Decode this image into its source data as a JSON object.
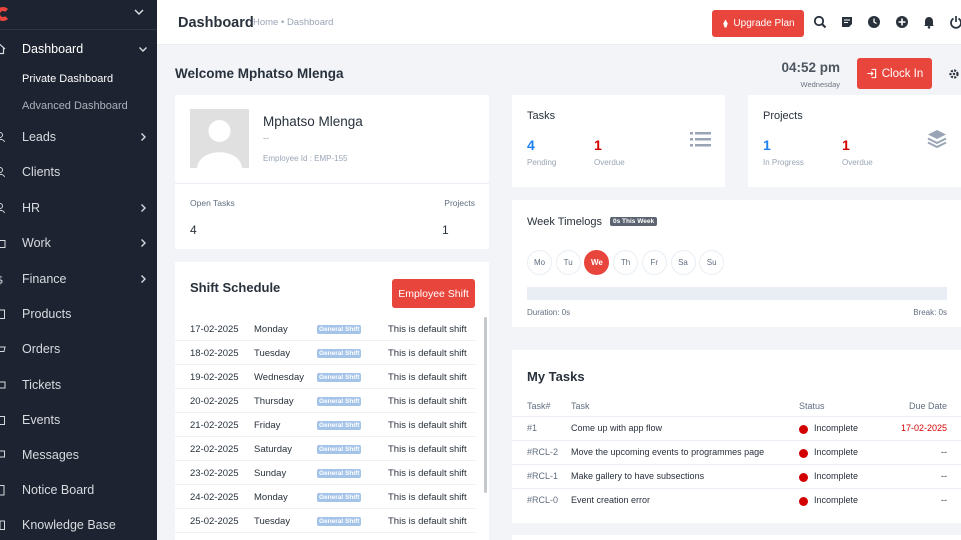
{
  "colors": {
    "accent": "#e8453c",
    "sidebar": "#1d2330",
    "blue": "#1d82f5",
    "red": "#d30000"
  },
  "sidebar": {
    "items": [
      {
        "label": "Dashboard",
        "icon": "house-icon",
        "chevron": "down"
      },
      {
        "label": "Leads",
        "icon": "user-icon",
        "chevron": "right"
      },
      {
        "label": "Clients",
        "icon": "users-icon",
        "chevron": ""
      },
      {
        "label": "HR",
        "icon": "people-icon",
        "chevron": "right"
      },
      {
        "label": "Work",
        "icon": "briefcase-icon",
        "chevron": "right"
      },
      {
        "label": "Finance",
        "icon": "dollar-icon",
        "chevron": "right"
      },
      {
        "label": "Products",
        "icon": "box-icon",
        "chevron": ""
      },
      {
        "label": "Orders",
        "icon": "cart-icon",
        "chevron": ""
      },
      {
        "label": "Tickets",
        "icon": "ticket-icon",
        "chevron": ""
      },
      {
        "label": "Events",
        "icon": "calendar-icon",
        "chevron": ""
      },
      {
        "label": "Messages",
        "icon": "message-icon",
        "chevron": ""
      },
      {
        "label": "Notice Board",
        "icon": "clipboard-icon",
        "chevron": ""
      },
      {
        "label": "Knowledge Base",
        "icon": "book-icon",
        "chevron": ""
      }
    ],
    "sub": [
      "Private Dashboard",
      "Advanced Dashboard"
    ]
  },
  "header": {
    "title": "Dashboard",
    "breadcrumb": "Home • Dashboard",
    "upgrade": "Upgrade Plan",
    "icons": [
      "search-icon",
      "sticky-note-icon",
      "clock-icon",
      "plus-circle-icon",
      "bell-icon",
      "power-icon"
    ]
  },
  "welcome": "Welcome Mphatso Mlenga",
  "clock": {
    "time": "04:52 pm",
    "day": "Wednesday",
    "button": "Clock In"
  },
  "profile": {
    "name": "Mphatso Mlenga",
    "designation": "--",
    "employee_id": "Employee Id : EMP-155",
    "open_tasks_label": "Open Tasks",
    "open_tasks": "4",
    "projects_label": "Projects",
    "projects": "1"
  },
  "shift": {
    "title": "Shift Schedule",
    "button": "Employee Shift",
    "rows": [
      {
        "date": "17-02-2025",
        "day": "Monday",
        "shift": "General Shift",
        "note": "This is default shift"
      },
      {
        "date": "18-02-2025",
        "day": "Tuesday",
        "shift": "General Shift",
        "note": "This is default shift"
      },
      {
        "date": "19-02-2025",
        "day": "Wednesday",
        "shift": "General Shift",
        "note": "This is default shift"
      },
      {
        "date": "20-02-2025",
        "day": "Thursday",
        "shift": "General Shift",
        "note": "This is default shift"
      },
      {
        "date": "21-02-2025",
        "day": "Friday",
        "shift": "General Shift",
        "note": "This is default shift"
      },
      {
        "date": "22-02-2025",
        "day": "Saturday",
        "shift": "General Shift",
        "note": "This is default shift"
      },
      {
        "date": "23-02-2025",
        "day": "Sunday",
        "shift": "General Shift",
        "note": "This is default shift"
      },
      {
        "date": "24-02-2025",
        "day": "Monday",
        "shift": "General Shift",
        "note": "This is default shift"
      },
      {
        "date": "25-02-2025",
        "day": "Tuesday",
        "shift": "General Shift",
        "note": "This is default shift"
      }
    ]
  },
  "tasks": {
    "title": "Tasks",
    "pending": "4",
    "pending_label": "Pending",
    "overdue": "1",
    "overdue_label": "Overdue"
  },
  "projects": {
    "title": "Projects",
    "in_progress": "1",
    "in_progress_label": "In Progress",
    "overdue": "1",
    "overdue_label": "Overdue"
  },
  "timelogs": {
    "title": "Week Timelogs",
    "badge": "0s This Week",
    "days": [
      "Mo",
      "Tu",
      "We",
      "Th",
      "Fr",
      "Sa",
      "Su"
    ],
    "active_day": "We",
    "duration": "Duration: 0s",
    "break": "Break: 0s"
  },
  "my_tasks": {
    "title": "My Tasks",
    "headers": [
      "Task#",
      "Task",
      "Status",
      "Due Date"
    ],
    "rows": [
      {
        "id": "#1",
        "task": "Come up with app flow",
        "status": "Incomplete",
        "due": "17-02-2025"
      },
      {
        "id": "#RCL-2",
        "task": "Move the upcoming events to programmes page",
        "status": "Incomplete",
        "due": "--"
      },
      {
        "id": "#RCL-1",
        "task": "Make gallery to have subsections",
        "status": "Incomplete",
        "due": "--"
      },
      {
        "id": "#RCL-0",
        "task": "Event creation error",
        "status": "Incomplete",
        "due": "--"
      }
    ]
  }
}
